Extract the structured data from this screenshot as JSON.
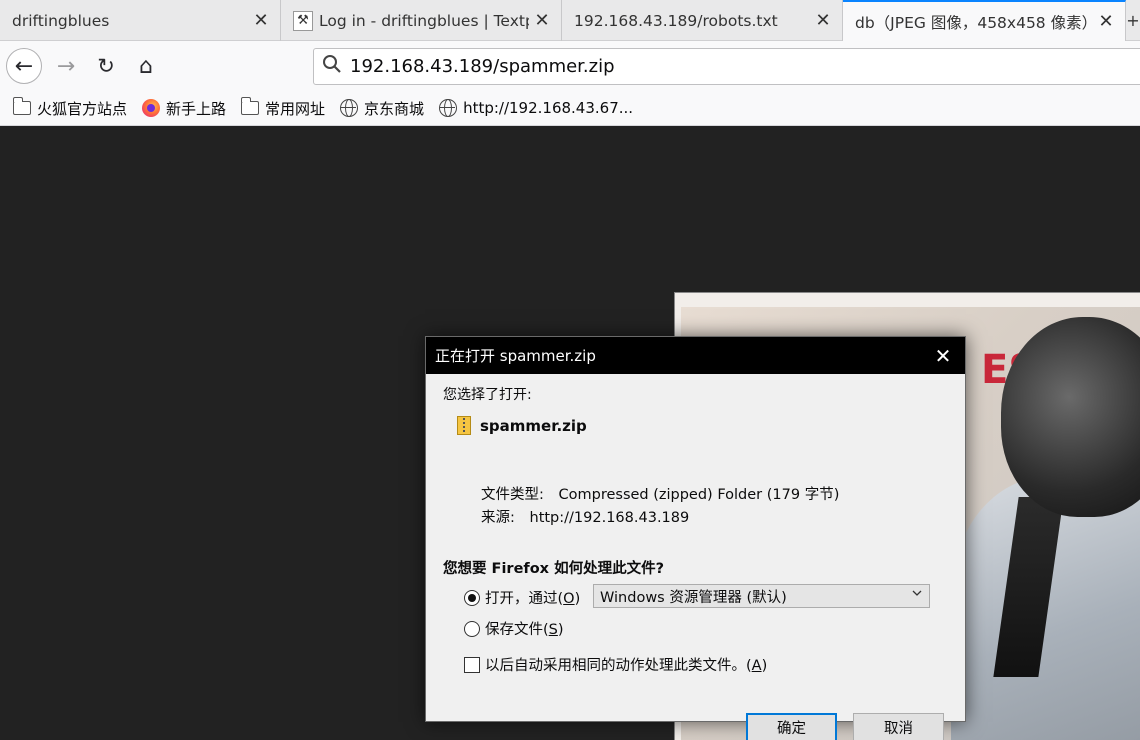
{
  "tabs": [
    {
      "title": "driftingblues",
      "close": "✕"
    },
    {
      "title": "Log in - driftingblues | Textpa",
      "close": "✕",
      "favicon": "⚒"
    },
    {
      "title": "192.168.43.189/robots.txt",
      "close": "✕"
    },
    {
      "title": "db（JPEG 图像，458x458 像素）",
      "close": "✕",
      "active": true
    }
  ],
  "new_tab": "+",
  "nav": {
    "back": "←",
    "forward": "→",
    "reload": "↻",
    "home": "⌂",
    "url": "192.168.43.189/spammer.zip",
    "search_icon": "search-icon"
  },
  "bookmarks": [
    {
      "label": "火狐官方站点",
      "icon": "folder-icon"
    },
    {
      "label": "新手上路",
      "icon": "firefox-icon"
    },
    {
      "label": "常用网址",
      "icon": "folder-icon"
    },
    {
      "label": "京东商城",
      "icon": "globe-icon"
    },
    {
      "label": "http://192.168.43.67...",
      "icon": "globe-icon"
    }
  ],
  "image_text": "ES",
  "dialog": {
    "title": "正在打开 spammer.zip",
    "close": "✕",
    "selected_label": "您选择了打开:",
    "file_name": "spammer.zip",
    "type_label": "文件类型:",
    "type_value": "Compressed (zipped) Folder (179 字节)",
    "source_label": "来源:",
    "source_value": "http://192.168.43.189",
    "question": "您想要 Firefox 如何处理此文件?",
    "open_with_label": "打开，通过(",
    "open_with_key": "O",
    "open_with_suffix": ")",
    "open_with_app": "Windows 资源管理器 (默认)",
    "save_label": "保存文件(",
    "save_key": "S",
    "save_suffix": ")",
    "auto_label": "以后自动采用相同的动作处理此类文件。(",
    "auto_key": "A",
    "auto_suffix": ")",
    "ok": "确定",
    "cancel": "取消"
  }
}
